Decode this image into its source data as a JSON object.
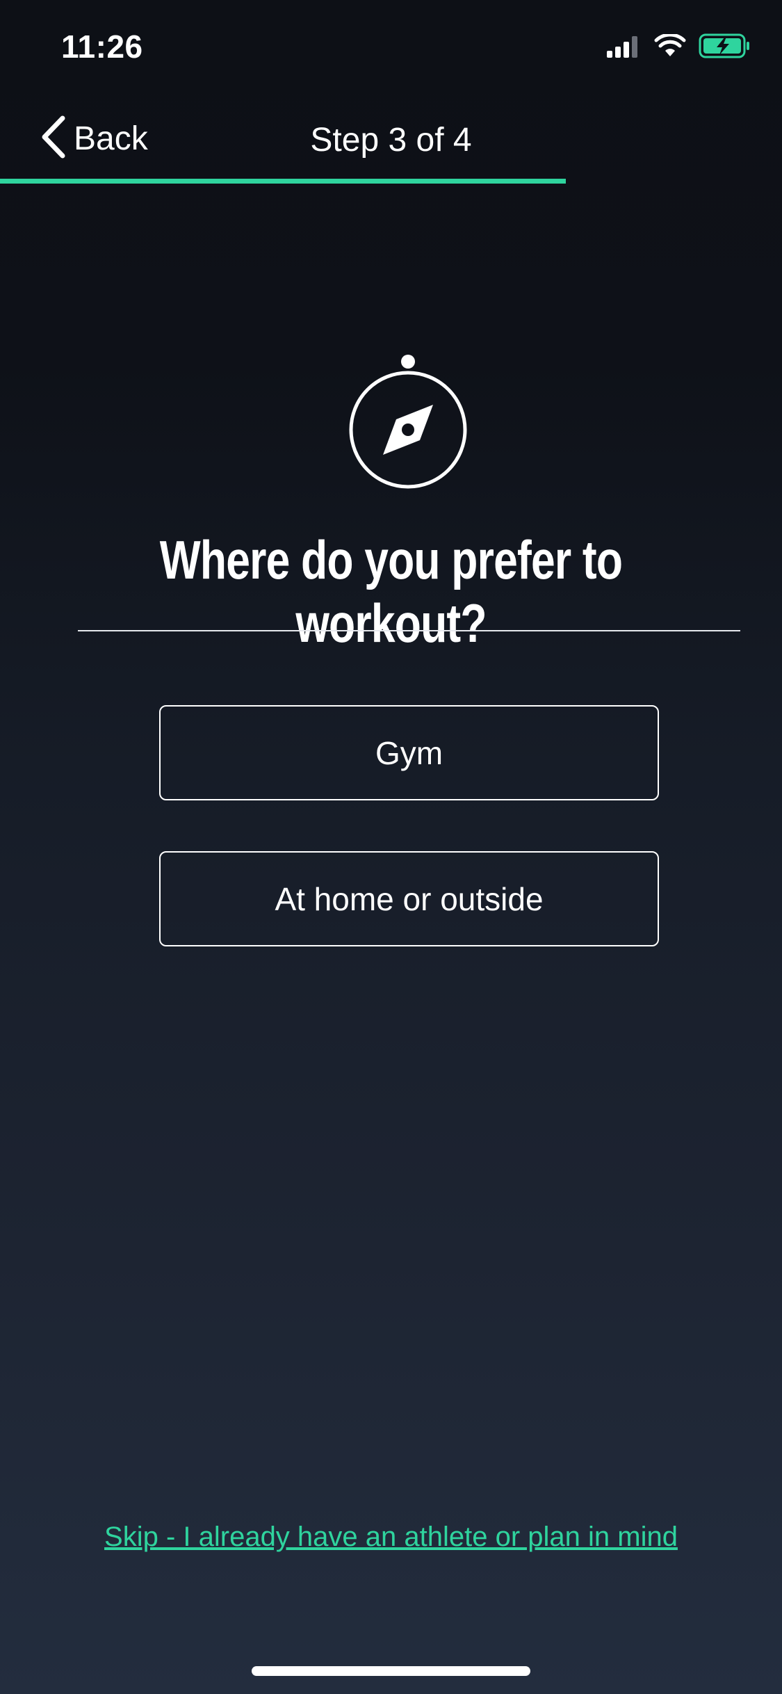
{
  "status_bar": {
    "time": "11:26",
    "icons": [
      "cellular-signal-icon",
      "wifi-icon",
      "battery-charging-icon"
    ],
    "battery_color": "#2fd49e"
  },
  "nav": {
    "back_label": "Back",
    "step_title": "Step 3 of 4",
    "progress_fraction": 0.75
  },
  "content": {
    "icon": "compass-icon",
    "question": "Where do you prefer to workout?",
    "options": [
      {
        "label": "Gym"
      },
      {
        "label": "At home or outside"
      }
    ],
    "skip_link": "Skip - I already have an athlete or plan in mind"
  },
  "colors": {
    "accent": "#2fd49e",
    "background_top": "#0d1016",
    "background_bottom": "#232d3e"
  }
}
